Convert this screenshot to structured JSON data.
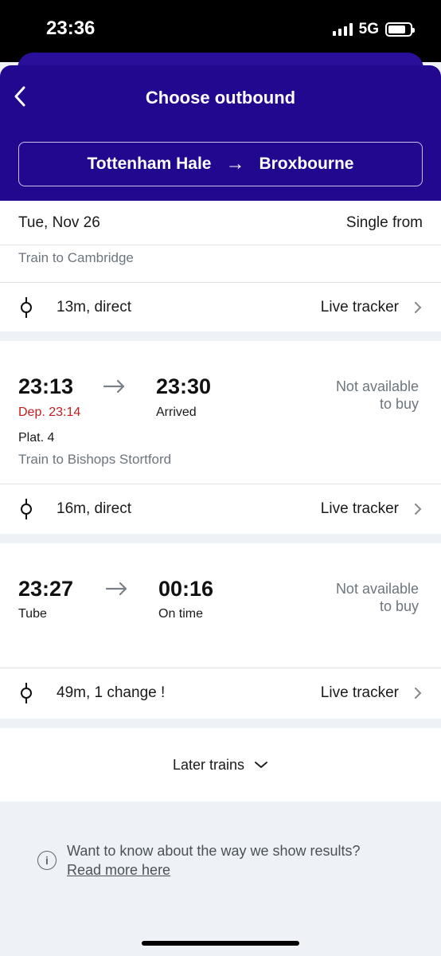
{
  "status_bar": {
    "time": "23:36",
    "network": "5G"
  },
  "header": {
    "title": "Choose outbound",
    "origin": "Tottenham Hale",
    "route_arrow": "→",
    "destination": "Broxbourne"
  },
  "date_bar": {
    "date": "Tue, Nov 26",
    "ticket_type": "Single from"
  },
  "results": [
    {
      "destination_line": "Train to Cambridge",
      "summary": "13m, direct",
      "tracker_label": "Live tracker"
    },
    {
      "depart_time": "23:13",
      "depart_status": "Dep. 23:14",
      "arrive_time": "23:30",
      "arrive_status": "Arrived",
      "availability_line1": "Not available",
      "availability_line2": "to buy",
      "platform": "Plat. 4",
      "destination_line": "Train to Bishops Stortford",
      "summary": "16m, direct",
      "tracker_label": "Live tracker"
    },
    {
      "depart_time": "23:27",
      "depart_status": "Tube",
      "arrive_time": "00:16",
      "arrive_status": "On time",
      "availability_line1": "Not available",
      "availability_line2": "to buy",
      "summary": "49m, 1 change !",
      "tracker_label": "Live tracker"
    }
  ],
  "later_trains": {
    "label": "Later trains"
  },
  "info": {
    "question": "Want to know about the way we show results?",
    "link": "Read more here"
  },
  "colors": {
    "header_bg": "#22088f",
    "delay_red": "#c21d1d",
    "muted_text": "#6d757d"
  }
}
